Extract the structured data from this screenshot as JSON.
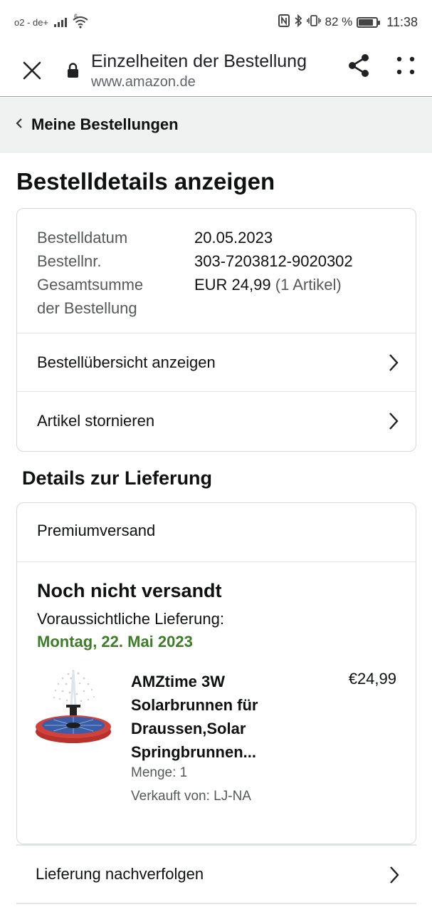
{
  "status_bar": {
    "carrier": "o2 - de+",
    "network_badge": "6",
    "battery_percent": "82 %",
    "battery_level": 0.82,
    "time": "11:38"
  },
  "browser": {
    "page_title": "Einzelheiten der Bestellung",
    "url": "www.amazon.de"
  },
  "nav": {
    "back_label": "Meine Bestellungen"
  },
  "page": {
    "title": "Bestelldetails anzeigen"
  },
  "order": {
    "date_label": "Bestelldatum",
    "date_value": "20.05.2023",
    "number_label": "Bestellnr.",
    "number_value": "303-7203812-9020302",
    "total_label_line1": "Gesamtsumme",
    "total_label_line2": "der Bestellung",
    "total_value": "EUR 24,99",
    "total_items": "(1 Artikel)",
    "links": [
      {
        "label": "Bestellübersicht anzeigen"
      },
      {
        "label": "Artikel stornieren"
      }
    ]
  },
  "delivery": {
    "section_title": "Details zur Lieferung",
    "shipping_method": "Premiumversand",
    "status": "Noch nicht versandt",
    "eta_label": "Voraussichtliche Lieferung:",
    "eta_date": "Montag, 22. Mai 2023",
    "product": {
      "title_lines": [
        "AMZtime 3W",
        "Solarbrunnen für",
        "Draussen,Solar",
        "Springbrunnen..."
      ],
      "price": "€24,99",
      "quantity": "Menge: 1",
      "seller": "Verkauft von: LJ-NA"
    },
    "track_label": "Lieferung nachverfolgen"
  },
  "colors": {
    "eta_green": "#3d7d28",
    "back_bar_bg": "#f0f2f2",
    "card_border": "#d5d9d9"
  },
  "icons": [
    "close-icon",
    "lock-icon",
    "share-icon",
    "more-icon",
    "chevron-left-icon",
    "chevron-right-icon",
    "wifi-icon",
    "signal-icon",
    "nfc-icon",
    "bluetooth-icon",
    "vibrate-icon",
    "battery-icon"
  ]
}
